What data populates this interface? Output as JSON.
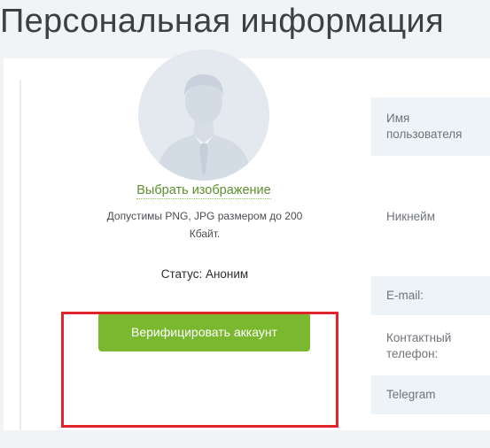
{
  "page": {
    "title": "Персональная информация"
  },
  "profile": {
    "choose_image_label": "Выбрать изображение",
    "image_hint_line1": "Допустимы PNG, JPG размером до 200",
    "image_hint_line2": "Кбайт.",
    "status_text": "Статус: Аноним",
    "verify_button_label": "Верифицировать аккаунт"
  },
  "fields": {
    "username_line1": "Имя",
    "username_line2": "пользователя",
    "nickname": "Никнейм",
    "email": "E-mail:",
    "phone_line1": "Контактный",
    "phone_line2": "телефон:",
    "telegram": "Telegram"
  },
  "colors": {
    "accent_green": "#7ab82f",
    "link_green": "#5d8f2e",
    "highlight_red": "#e1232a",
    "avatar_bg": "#e4e9ef",
    "field_shade": "#eef3f8"
  },
  "icons": {
    "avatar": "user-silhouette-icon"
  }
}
